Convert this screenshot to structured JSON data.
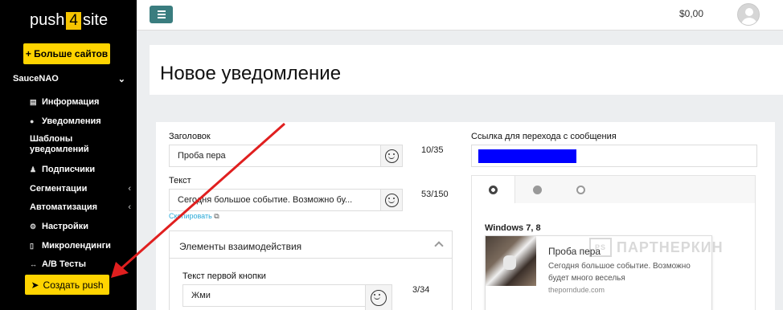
{
  "logo": {
    "left": "push",
    "mid": "4",
    "right": "site"
  },
  "sidebar": {
    "more_sites": "+ Больше сайтов",
    "site_name": "SauceNAO",
    "items": [
      {
        "label": "Информация"
      },
      {
        "label": "Уведомления"
      },
      {
        "label": "Шаблоны уведомлений"
      },
      {
        "label": "Подписчики"
      },
      {
        "label": "Сегментации"
      },
      {
        "label": "Автоматизация"
      },
      {
        "label": "Настройки"
      },
      {
        "label": "Микролендинги"
      },
      {
        "label": "A/B Тесты"
      }
    ],
    "create_push": "Создать push"
  },
  "topbar": {
    "balance": "$0,00"
  },
  "page": {
    "title": "Новое уведомление"
  },
  "form": {
    "headline_label": "Заголовок",
    "headline_value": "Проба пера",
    "headline_counter": "10/35",
    "text_label": "Текст",
    "text_value": "Сегодня большое событие. Возможно бу...",
    "text_counter": "53/150",
    "copy_link": "Скопировать",
    "interaction_title": "Элементы взаимодействия",
    "first_button_label": "Текст первой кнопки",
    "first_button_value": "Жми",
    "first_button_counter": "3/34",
    "link_label": "Ссылка для перехода с сообщения",
    "preview": {
      "os": "Windows 7, 8",
      "title": "Проба пера",
      "body": "Сегодня большое событие. Возможно будет много веселья",
      "domain": "theporndude.com"
    }
  },
  "watermark": "ПАРТНЕРКИН",
  "colors": {
    "accent": "#ffd400",
    "sidebar": "#000000",
    "link": "#29a9d8",
    "arrow": "#e01f1f",
    "hamburger": "#3a7d7f"
  }
}
